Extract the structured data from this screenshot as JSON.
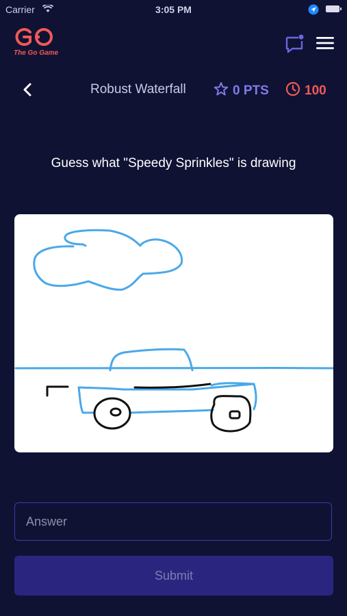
{
  "status_bar": {
    "carrier": "Carrier",
    "time": "3:05 PM"
  },
  "brand": {
    "logo_text": "The Go Game",
    "color": "#ef5a55"
  },
  "header": {
    "game_name": "Robust Waterfall",
    "points": "0 PTS",
    "timer": "100",
    "points_color": "#7f7be6",
    "timer_color": "#ef5a55"
  },
  "prompt": "Guess what \"Speedy Sprinkles\" is drawing",
  "answer": {
    "placeholder": "Answer",
    "value": ""
  },
  "submit_label": "Submit",
  "icons": {
    "back": "chevron-left-icon",
    "chat": "chat-icon",
    "menu": "hamburger-menu-icon",
    "star": "star-icon",
    "clock": "clock-icon"
  }
}
